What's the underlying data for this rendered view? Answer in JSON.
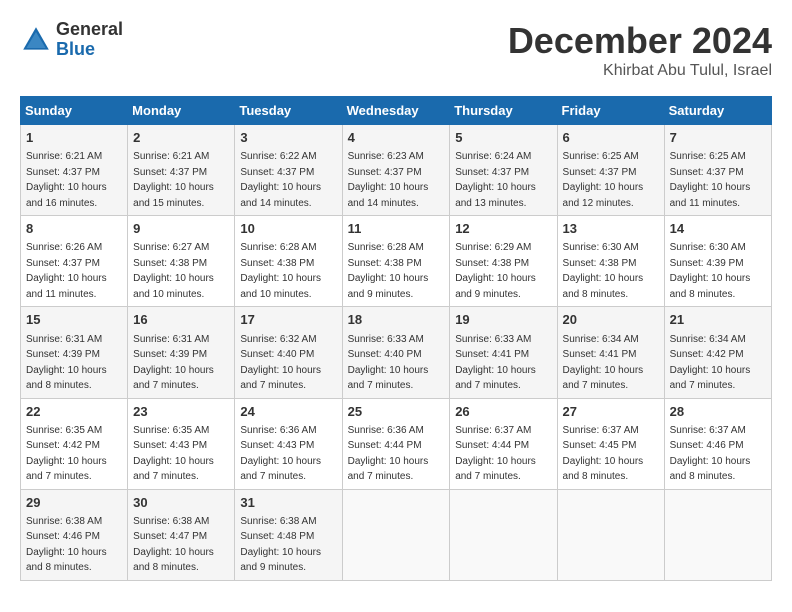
{
  "header": {
    "logo_general": "General",
    "logo_blue": "Blue",
    "month": "December 2024",
    "location": "Khirbat Abu Tulul, Israel"
  },
  "weekdays": [
    "Sunday",
    "Monday",
    "Tuesday",
    "Wednesday",
    "Thursday",
    "Friday",
    "Saturday"
  ],
  "weeks": [
    [
      {
        "day": "1",
        "sunrise": "6:21 AM",
        "sunset": "4:37 PM",
        "daylight": "10 hours and 16 minutes."
      },
      {
        "day": "2",
        "sunrise": "6:21 AM",
        "sunset": "4:37 PM",
        "daylight": "10 hours and 15 minutes."
      },
      {
        "day": "3",
        "sunrise": "6:22 AM",
        "sunset": "4:37 PM",
        "daylight": "10 hours and 14 minutes."
      },
      {
        "day": "4",
        "sunrise": "6:23 AM",
        "sunset": "4:37 PM",
        "daylight": "10 hours and 14 minutes."
      },
      {
        "day": "5",
        "sunrise": "6:24 AM",
        "sunset": "4:37 PM",
        "daylight": "10 hours and 13 minutes."
      },
      {
        "day": "6",
        "sunrise": "6:25 AM",
        "sunset": "4:37 PM",
        "daylight": "10 hours and 12 minutes."
      },
      {
        "day": "7",
        "sunrise": "6:25 AM",
        "sunset": "4:37 PM",
        "daylight": "10 hours and 11 minutes."
      }
    ],
    [
      {
        "day": "8",
        "sunrise": "6:26 AM",
        "sunset": "4:37 PM",
        "daylight": "10 hours and 11 minutes."
      },
      {
        "day": "9",
        "sunrise": "6:27 AM",
        "sunset": "4:38 PM",
        "daylight": "10 hours and 10 minutes."
      },
      {
        "day": "10",
        "sunrise": "6:28 AM",
        "sunset": "4:38 PM",
        "daylight": "10 hours and 10 minutes."
      },
      {
        "day": "11",
        "sunrise": "6:28 AM",
        "sunset": "4:38 PM",
        "daylight": "10 hours and 9 minutes."
      },
      {
        "day": "12",
        "sunrise": "6:29 AM",
        "sunset": "4:38 PM",
        "daylight": "10 hours and 9 minutes."
      },
      {
        "day": "13",
        "sunrise": "6:30 AM",
        "sunset": "4:38 PM",
        "daylight": "10 hours and 8 minutes."
      },
      {
        "day": "14",
        "sunrise": "6:30 AM",
        "sunset": "4:39 PM",
        "daylight": "10 hours and 8 minutes."
      }
    ],
    [
      {
        "day": "15",
        "sunrise": "6:31 AM",
        "sunset": "4:39 PM",
        "daylight": "10 hours and 8 minutes."
      },
      {
        "day": "16",
        "sunrise": "6:31 AM",
        "sunset": "4:39 PM",
        "daylight": "10 hours and 7 minutes."
      },
      {
        "day": "17",
        "sunrise": "6:32 AM",
        "sunset": "4:40 PM",
        "daylight": "10 hours and 7 minutes."
      },
      {
        "day": "18",
        "sunrise": "6:33 AM",
        "sunset": "4:40 PM",
        "daylight": "10 hours and 7 minutes."
      },
      {
        "day": "19",
        "sunrise": "6:33 AM",
        "sunset": "4:41 PM",
        "daylight": "10 hours and 7 minutes."
      },
      {
        "day": "20",
        "sunrise": "6:34 AM",
        "sunset": "4:41 PM",
        "daylight": "10 hours and 7 minutes."
      },
      {
        "day": "21",
        "sunrise": "6:34 AM",
        "sunset": "4:42 PM",
        "daylight": "10 hours and 7 minutes."
      }
    ],
    [
      {
        "day": "22",
        "sunrise": "6:35 AM",
        "sunset": "4:42 PM",
        "daylight": "10 hours and 7 minutes."
      },
      {
        "day": "23",
        "sunrise": "6:35 AM",
        "sunset": "4:43 PM",
        "daylight": "10 hours and 7 minutes."
      },
      {
        "day": "24",
        "sunrise": "6:36 AM",
        "sunset": "4:43 PM",
        "daylight": "10 hours and 7 minutes."
      },
      {
        "day": "25",
        "sunrise": "6:36 AM",
        "sunset": "4:44 PM",
        "daylight": "10 hours and 7 minutes."
      },
      {
        "day": "26",
        "sunrise": "6:37 AM",
        "sunset": "4:44 PM",
        "daylight": "10 hours and 7 minutes."
      },
      {
        "day": "27",
        "sunrise": "6:37 AM",
        "sunset": "4:45 PM",
        "daylight": "10 hours and 8 minutes."
      },
      {
        "day": "28",
        "sunrise": "6:37 AM",
        "sunset": "4:46 PM",
        "daylight": "10 hours and 8 minutes."
      }
    ],
    [
      {
        "day": "29",
        "sunrise": "6:38 AM",
        "sunset": "4:46 PM",
        "daylight": "10 hours and 8 minutes."
      },
      {
        "day": "30",
        "sunrise": "6:38 AM",
        "sunset": "4:47 PM",
        "daylight": "10 hours and 8 minutes."
      },
      {
        "day": "31",
        "sunrise": "6:38 AM",
        "sunset": "4:48 PM",
        "daylight": "10 hours and 9 minutes."
      },
      null,
      null,
      null,
      null
    ]
  ]
}
